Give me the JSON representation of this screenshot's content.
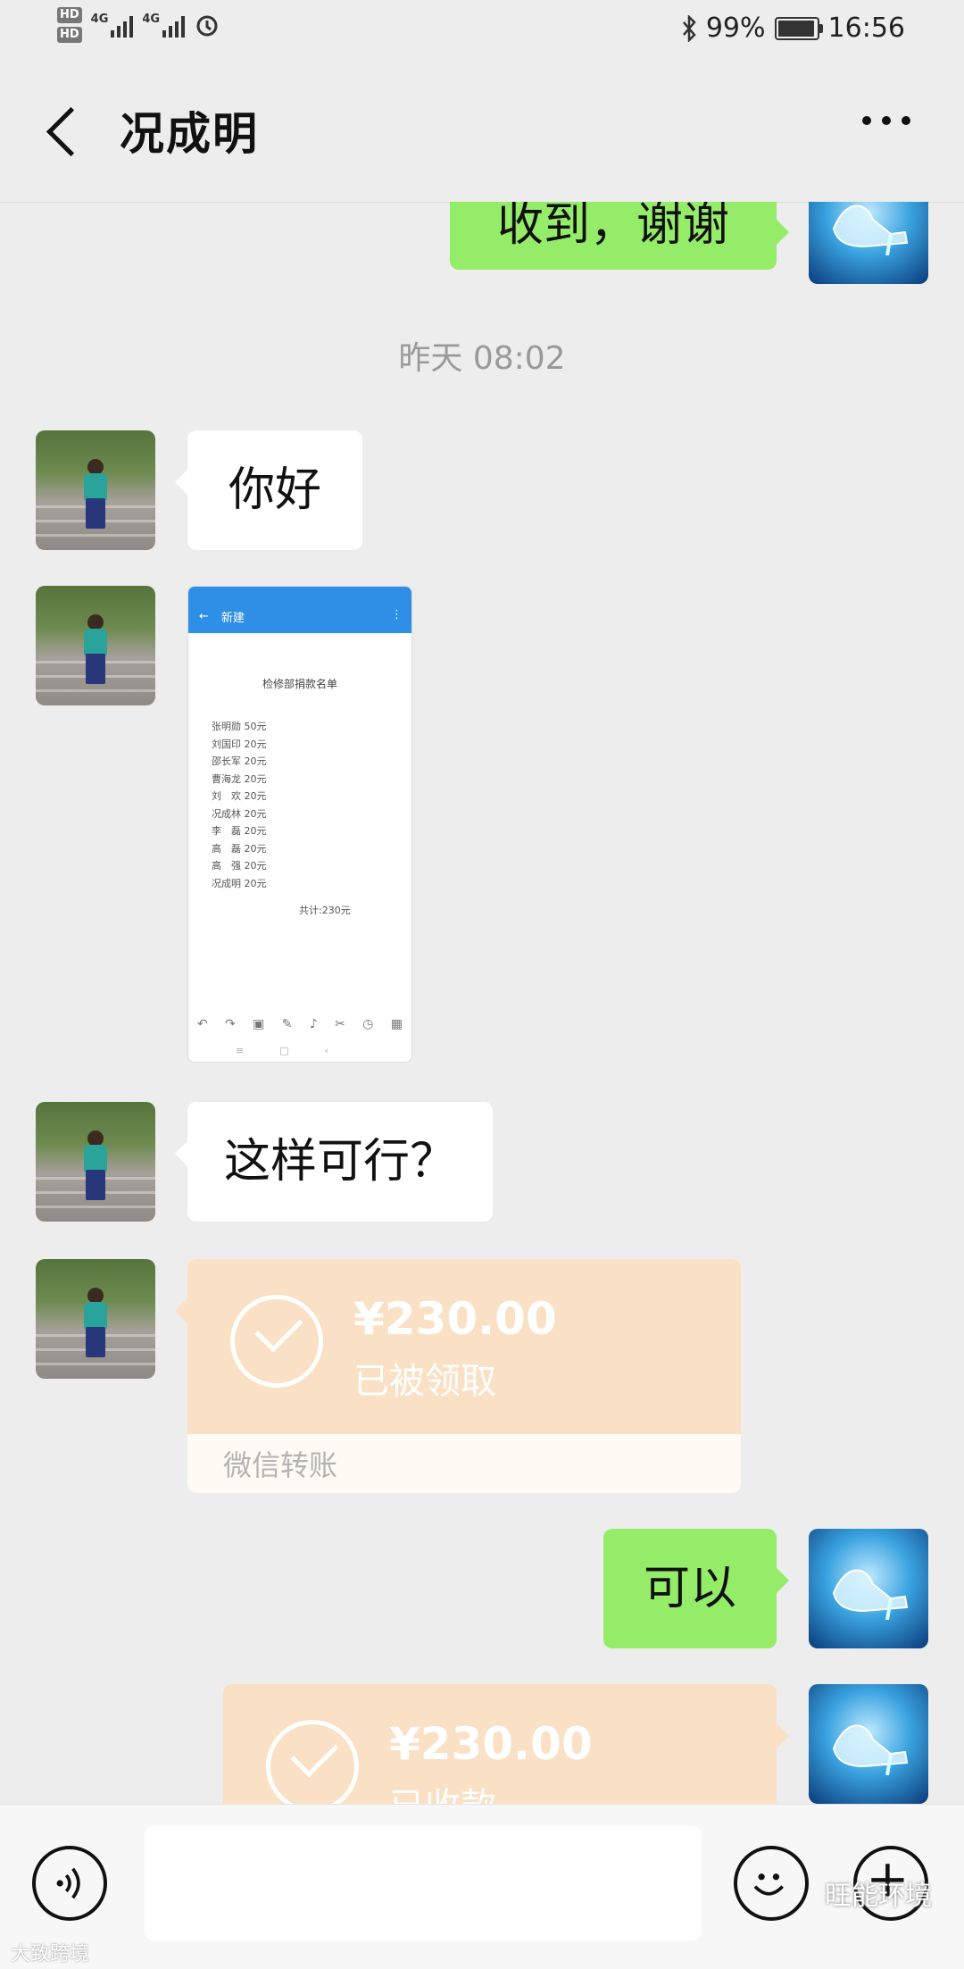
{
  "status_bar": {
    "hd1": "HD",
    "hd2": "HD",
    "net1": "4G",
    "net2": "4G",
    "battery_pct": "99%",
    "time": "16:56"
  },
  "header": {
    "title": "况成明"
  },
  "messages": {
    "top_partial": "收到，谢谢",
    "timestamp": "昨天 08:02",
    "hello": "你好",
    "question": "这样可行？",
    "ok": "可以"
  },
  "shared_image": {
    "topbar_title": "新建",
    "heading": "检修部捐款名单",
    "rows": [
      "张明勋  50元",
      "刘国印  20元",
      "邵长军  20元",
      "曹海龙  20元",
      "刘　欢  20元",
      "况成林  20元",
      "李　磊  20元",
      "高　磊  20元",
      "高　强  20元",
      "况成明  20元"
    ],
    "total": "共计:230元"
  },
  "transfer_received": {
    "amount": "¥230.00",
    "status": "已被领取",
    "footer": "微信转账"
  },
  "transfer_sent": {
    "amount": "¥230.00",
    "status": "已收款"
  },
  "input_bar": {
    "placeholder": ""
  },
  "watermarks": {
    "left": "大致跨境",
    "right": "旺能环境"
  },
  "colors": {
    "green_bubble": "#95ec69",
    "transfer": "#fae0c4",
    "background": "#ededed"
  }
}
